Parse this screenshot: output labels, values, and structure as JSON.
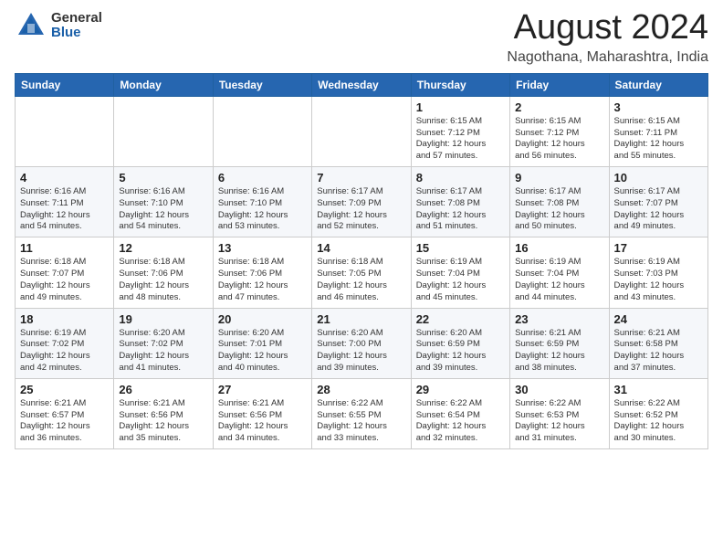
{
  "header": {
    "logo_general": "General",
    "logo_blue": "Blue",
    "main_title": "August 2024",
    "subtitle": "Nagothana, Maharashtra, India"
  },
  "weekdays": [
    "Sunday",
    "Monday",
    "Tuesday",
    "Wednesday",
    "Thursday",
    "Friday",
    "Saturday"
  ],
  "weeks": [
    [
      {
        "day": "",
        "info": ""
      },
      {
        "day": "",
        "info": ""
      },
      {
        "day": "",
        "info": ""
      },
      {
        "day": "",
        "info": ""
      },
      {
        "day": "1",
        "info": "Sunrise: 6:15 AM\nSunset: 7:12 PM\nDaylight: 12 hours\nand 57 minutes."
      },
      {
        "day": "2",
        "info": "Sunrise: 6:15 AM\nSunset: 7:12 PM\nDaylight: 12 hours\nand 56 minutes."
      },
      {
        "day": "3",
        "info": "Sunrise: 6:15 AM\nSunset: 7:11 PM\nDaylight: 12 hours\nand 55 minutes."
      }
    ],
    [
      {
        "day": "4",
        "info": "Sunrise: 6:16 AM\nSunset: 7:11 PM\nDaylight: 12 hours\nand 54 minutes."
      },
      {
        "day": "5",
        "info": "Sunrise: 6:16 AM\nSunset: 7:10 PM\nDaylight: 12 hours\nand 54 minutes."
      },
      {
        "day": "6",
        "info": "Sunrise: 6:16 AM\nSunset: 7:10 PM\nDaylight: 12 hours\nand 53 minutes."
      },
      {
        "day": "7",
        "info": "Sunrise: 6:17 AM\nSunset: 7:09 PM\nDaylight: 12 hours\nand 52 minutes."
      },
      {
        "day": "8",
        "info": "Sunrise: 6:17 AM\nSunset: 7:08 PM\nDaylight: 12 hours\nand 51 minutes."
      },
      {
        "day": "9",
        "info": "Sunrise: 6:17 AM\nSunset: 7:08 PM\nDaylight: 12 hours\nand 50 minutes."
      },
      {
        "day": "10",
        "info": "Sunrise: 6:17 AM\nSunset: 7:07 PM\nDaylight: 12 hours\nand 49 minutes."
      }
    ],
    [
      {
        "day": "11",
        "info": "Sunrise: 6:18 AM\nSunset: 7:07 PM\nDaylight: 12 hours\nand 49 minutes."
      },
      {
        "day": "12",
        "info": "Sunrise: 6:18 AM\nSunset: 7:06 PM\nDaylight: 12 hours\nand 48 minutes."
      },
      {
        "day": "13",
        "info": "Sunrise: 6:18 AM\nSunset: 7:06 PM\nDaylight: 12 hours\nand 47 minutes."
      },
      {
        "day": "14",
        "info": "Sunrise: 6:18 AM\nSunset: 7:05 PM\nDaylight: 12 hours\nand 46 minutes."
      },
      {
        "day": "15",
        "info": "Sunrise: 6:19 AM\nSunset: 7:04 PM\nDaylight: 12 hours\nand 45 minutes."
      },
      {
        "day": "16",
        "info": "Sunrise: 6:19 AM\nSunset: 7:04 PM\nDaylight: 12 hours\nand 44 minutes."
      },
      {
        "day": "17",
        "info": "Sunrise: 6:19 AM\nSunset: 7:03 PM\nDaylight: 12 hours\nand 43 minutes."
      }
    ],
    [
      {
        "day": "18",
        "info": "Sunrise: 6:19 AM\nSunset: 7:02 PM\nDaylight: 12 hours\nand 42 minutes."
      },
      {
        "day": "19",
        "info": "Sunrise: 6:20 AM\nSunset: 7:02 PM\nDaylight: 12 hours\nand 41 minutes."
      },
      {
        "day": "20",
        "info": "Sunrise: 6:20 AM\nSunset: 7:01 PM\nDaylight: 12 hours\nand 40 minutes."
      },
      {
        "day": "21",
        "info": "Sunrise: 6:20 AM\nSunset: 7:00 PM\nDaylight: 12 hours\nand 39 minutes."
      },
      {
        "day": "22",
        "info": "Sunrise: 6:20 AM\nSunset: 6:59 PM\nDaylight: 12 hours\nand 39 minutes."
      },
      {
        "day": "23",
        "info": "Sunrise: 6:21 AM\nSunset: 6:59 PM\nDaylight: 12 hours\nand 38 minutes."
      },
      {
        "day": "24",
        "info": "Sunrise: 6:21 AM\nSunset: 6:58 PM\nDaylight: 12 hours\nand 37 minutes."
      }
    ],
    [
      {
        "day": "25",
        "info": "Sunrise: 6:21 AM\nSunset: 6:57 PM\nDaylight: 12 hours\nand 36 minutes."
      },
      {
        "day": "26",
        "info": "Sunrise: 6:21 AM\nSunset: 6:56 PM\nDaylight: 12 hours\nand 35 minutes."
      },
      {
        "day": "27",
        "info": "Sunrise: 6:21 AM\nSunset: 6:56 PM\nDaylight: 12 hours\nand 34 minutes."
      },
      {
        "day": "28",
        "info": "Sunrise: 6:22 AM\nSunset: 6:55 PM\nDaylight: 12 hours\nand 33 minutes."
      },
      {
        "day": "29",
        "info": "Sunrise: 6:22 AM\nSunset: 6:54 PM\nDaylight: 12 hours\nand 32 minutes."
      },
      {
        "day": "30",
        "info": "Sunrise: 6:22 AM\nSunset: 6:53 PM\nDaylight: 12 hours\nand 31 minutes."
      },
      {
        "day": "31",
        "info": "Sunrise: 6:22 AM\nSunset: 6:52 PM\nDaylight: 12 hours\nand 30 minutes."
      }
    ]
  ]
}
